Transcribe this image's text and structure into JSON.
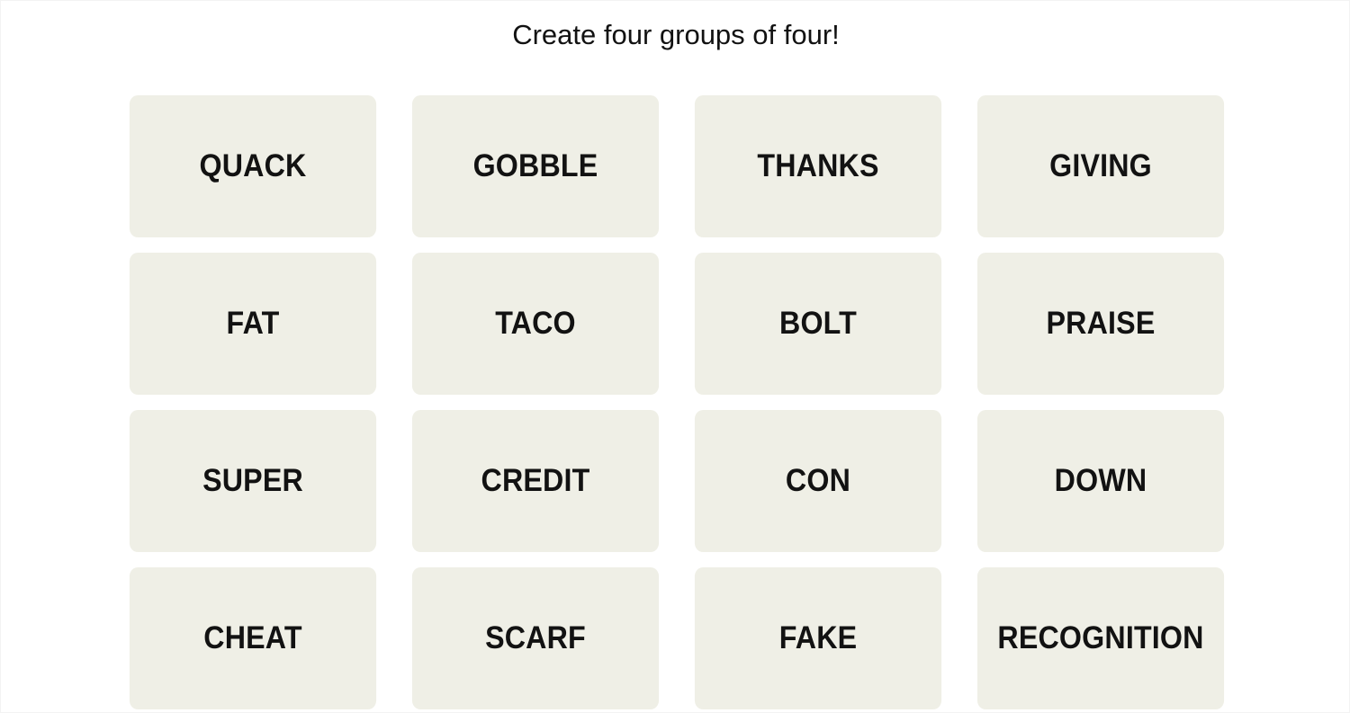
{
  "header": {
    "prompt": "Create four groups of four!"
  },
  "board": {
    "tile_color": "#efefe6",
    "text_color": "#121212",
    "tiles": [
      {
        "word": "QUACK"
      },
      {
        "word": "GOBBLE"
      },
      {
        "word": "THANKS"
      },
      {
        "word": "GIVING"
      },
      {
        "word": "FAT"
      },
      {
        "word": "TACO"
      },
      {
        "word": "BOLT"
      },
      {
        "word": "PRAISE"
      },
      {
        "word": "SUPER"
      },
      {
        "word": "CREDIT"
      },
      {
        "word": "CON"
      },
      {
        "word": "DOWN"
      },
      {
        "word": "CHEAT"
      },
      {
        "word": "SCARF"
      },
      {
        "word": "FAKE"
      },
      {
        "word": "RECOGNITION"
      }
    ]
  }
}
